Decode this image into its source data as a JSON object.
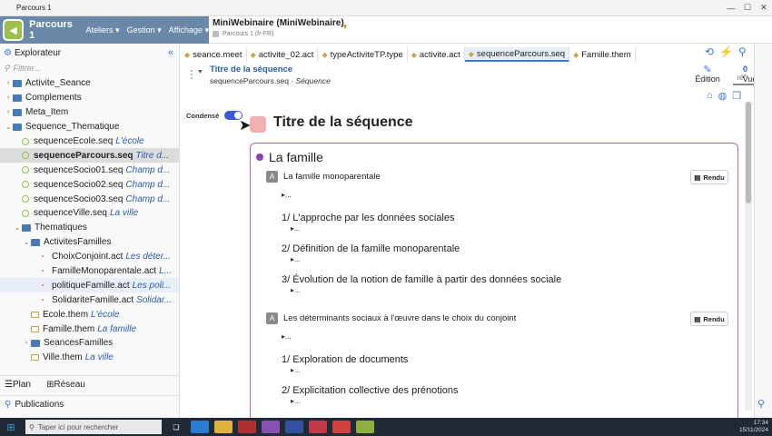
{
  "window": {
    "title": "Parcours 1",
    "controls": [
      "—",
      "☐",
      "✕"
    ]
  },
  "app": {
    "name": "Parcours 1",
    "menus": [
      "Ateliers ▾",
      "Gestion ▾",
      "Affichage ▾"
    ]
  },
  "project": {
    "name": "MiniWebinaire (MiniWebinaire)",
    "sub": "Parcours 1 (fr-FR)"
  },
  "explorer": {
    "title": "Explorateur",
    "filter_placeholder": "Filtrer...",
    "items": [
      {
        "label": "Activite_Seance",
        "desc": "",
        "kind": "folder",
        "arrow": "›",
        "indent": 0
      },
      {
        "label": "Complements",
        "desc": "",
        "kind": "folder",
        "arrow": "›",
        "indent": 0
      },
      {
        "label": "Meta_Item",
        "desc": "",
        "kind": "folder",
        "arrow": "›",
        "indent": 0
      },
      {
        "label": "Sequence_Thematique",
        "desc": "",
        "kind": "folder",
        "arrow": "⌄",
        "indent": 0
      },
      {
        "label": "sequenceEcole.seq",
        "desc": "L'école",
        "kind": "seq",
        "arrow": "",
        "indent": 1
      },
      {
        "label": "sequenceParcours.seq",
        "desc": "Titre d...",
        "kind": "seq",
        "arrow": "",
        "indent": 1,
        "selected": true
      },
      {
        "label": "sequenceSocio01.seq",
        "desc": "Champ d...",
        "kind": "seq",
        "arrow": "",
        "indent": 1
      },
      {
        "label": "sequenceSocio02.seq",
        "desc": "Champ d...",
        "kind": "seq",
        "arrow": "",
        "indent": 1
      },
      {
        "label": "sequenceSocio03.seq",
        "desc": "Champ d...",
        "kind": "seq",
        "arrow": "",
        "indent": 1
      },
      {
        "label": "sequenceVille.seq",
        "desc": "La ville",
        "kind": "seq",
        "arrow": "",
        "indent": 1
      },
      {
        "label": "Thematiques",
        "desc": "",
        "kind": "folder",
        "arrow": "⌄",
        "indent": 1
      },
      {
        "label": "ActivitesFamilles",
        "desc": "",
        "kind": "folder",
        "arrow": "⌄",
        "indent": 2
      },
      {
        "label": "ChoixConjoint.act",
        "desc": "Les déter...",
        "kind": "act",
        "arrow": "",
        "indent": 3
      },
      {
        "label": "FamilleMonoparentale.act",
        "desc": "L...",
        "kind": "act",
        "arrow": "",
        "indent": 3
      },
      {
        "label": "politiqueFamille.act",
        "desc": "Les poli...",
        "kind": "act",
        "arrow": "",
        "indent": 3,
        "highlight": true
      },
      {
        "label": "SolidariteFamille.act",
        "desc": "Solidar...",
        "kind": "act",
        "arrow": "",
        "indent": 3
      },
      {
        "label": "Ecole.them",
        "desc": "L'école",
        "kind": "them",
        "arrow": "",
        "indent": 2
      },
      {
        "label": "Famille.them",
        "desc": "La famille",
        "kind": "them",
        "arrow": "",
        "indent": 2
      },
      {
        "label": "SeancesFamilles",
        "desc": "",
        "kind": "folder",
        "arrow": "›",
        "indent": 2
      },
      {
        "label": "Ville.them",
        "desc": "La ville",
        "kind": "them",
        "arrow": "",
        "indent": 2
      }
    ],
    "bottom_tabs": [
      "Plan",
      "Réseau"
    ],
    "publications": "Publications"
  },
  "tabs": [
    {
      "label": "seance.meet",
      "active": false
    },
    {
      "label": "activite_02.act",
      "active": false
    },
    {
      "label": "typeActiviteTP.type",
      "active": false
    },
    {
      "label": "activite.act",
      "active": false
    },
    {
      "label": "sequenceParcours.seq",
      "active": true
    },
    {
      "label": "Famille.them",
      "active": false
    }
  ],
  "doc": {
    "title": "Titre de la séquence",
    "file": "sequenceParcours.seq",
    "type": "Séquence",
    "modes": [
      "Édition",
      "Vue web"
    ],
    "refs_count": "0",
    "refs_label": "réf."
  },
  "content": {
    "condense_label": "Condensé",
    "title": "Titre de la séquence",
    "theme": "La famille",
    "activities": [
      {
        "title": "La famille monoparentale",
        "rendu": "Rendu",
        "lines": [
          "1/ L'approche par les données sociales",
          "2/ Définition de la famille monoparentale",
          "3/ Évolution de la notion de famille à partir des données sociale"
        ]
      },
      {
        "title": "Les déterminants sociaux à l'œuvre dans le choix du conjoint",
        "rendu": "Rendu",
        "lines": [
          "1/ Exploration de documents",
          "2/ Explicitation collective des prénotions"
        ]
      }
    ],
    "ellipsis": "..."
  },
  "taskbar": {
    "search_placeholder": "Taper ici pour rechercher",
    "time": "17:34",
    "date": "15/11/2024"
  },
  "colors": {
    "brand": "#6a88a8",
    "accent": "#3a7bd5",
    "frame": "#a56fc6"
  }
}
